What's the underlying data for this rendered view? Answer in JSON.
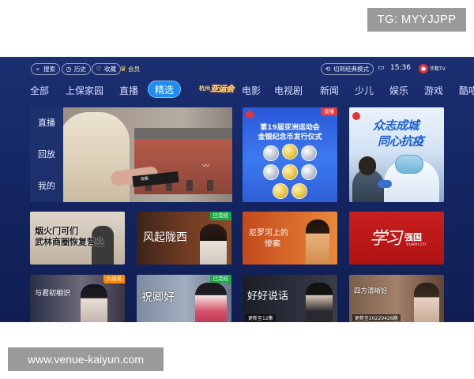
{
  "watermarks": {
    "top": "TG: MYYJJPP",
    "bottom": "www.venue-kaiyun.com"
  },
  "topbar": {
    "search": "搜索",
    "history": "历史",
    "favorites": "收藏",
    "vip": "会员",
    "mode_switch": "切到经典模式",
    "time": "15:36",
    "logo_text": "华数TV"
  },
  "tabs": {
    "items": [
      "全部",
      "上保家园",
      "直播",
      "精选",
      "电影",
      "电视剧",
      "新闻",
      "少儿",
      "娱乐",
      "游戏",
      "酷喵"
    ],
    "special": {
      "line1": "杭州",
      "line2": "亚运会"
    },
    "active": "精选"
  },
  "hero": {
    "menu": [
      "直播",
      "回放",
      "我的"
    ],
    "phone_label": "观看"
  },
  "cards": {
    "asia": {
      "badge": "直播",
      "line1": "第19届亚洲运动会",
      "line2": "金银纪念币发行仪式"
    },
    "epidemic": {
      "line1": "众志成城",
      "line2": "同心抗疫"
    },
    "wuhuo": {
      "line1": "烟火门可们",
      "line2": "武林商圈恢复营业"
    },
    "feng": {
      "title": "风起陇西",
      "badge": "已完结"
    },
    "nile": {
      "line1": "尼罗河上的",
      "line2": "惨案"
    },
    "xuexi": {
      "calligraphy": "学习",
      "title": "强国",
      "sub": "xuexi.cn"
    },
    "r3a": {
      "title": "与君初相识",
      "badge": "大结局"
    },
    "r3b": {
      "title": "祝卿好",
      "badge": "已完结"
    },
    "r3c": {
      "title": "好好说话",
      "update": "更新至12集"
    },
    "r3d": {
      "title": "四方清晰好",
      "update": "更新至20220426期"
    }
  }
}
